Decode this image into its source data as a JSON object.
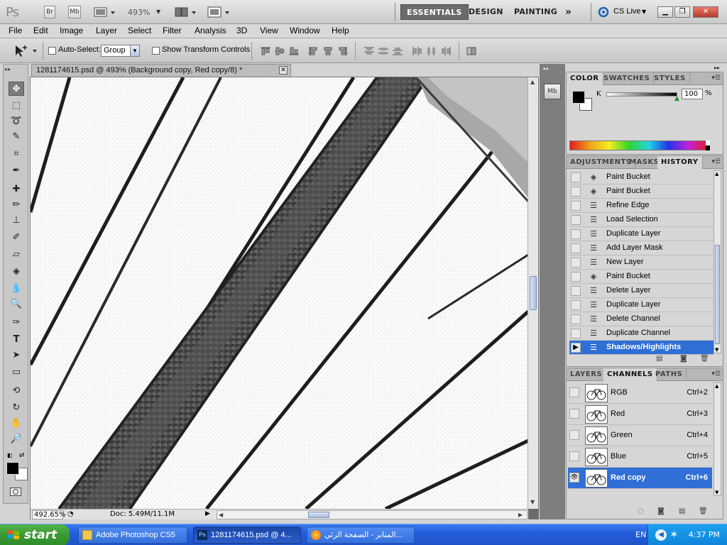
{
  "appbar": {
    "logo": "Ps",
    "btn_br": "Br",
    "btn_mb": "Mb",
    "zoom": "493%",
    "workspaces": [
      "ESSENTIALS",
      "DESIGN",
      "PAINTING"
    ],
    "more": "»",
    "cslive": "CS Live"
  },
  "menu": [
    "File",
    "Edit",
    "Image",
    "Layer",
    "Select",
    "Filter",
    "Analysis",
    "3D",
    "View",
    "Window",
    "Help"
  ],
  "options": {
    "auto_select_label": "Auto-Select:",
    "auto_select_value": "Group",
    "show_transform_label": "Show Transform Controls"
  },
  "document": {
    "tab_title": "1281174615.psd @ 493% (Background copy, Red copy/8) *",
    "zoom_field": "492.65%",
    "doc_info": "Doc: 5.49M/11.1M"
  },
  "color_panel": {
    "tabs": [
      "COLOR",
      "SWATCHES",
      "STYLES"
    ],
    "channel_label": "K",
    "value": "100",
    "unit": "%"
  },
  "history_panel": {
    "tabs": [
      "ADJUSTMENTS",
      "MASKS",
      "HISTORY"
    ],
    "items": [
      {
        "label": "Paint Bucket",
        "icon": "paint-bucket"
      },
      {
        "label": "Paint Bucket",
        "icon": "paint-bucket"
      },
      {
        "label": "Refine Edge",
        "icon": "document-step"
      },
      {
        "label": "Load Selection",
        "icon": "document-step"
      },
      {
        "label": "Duplicate Layer",
        "icon": "document-step"
      },
      {
        "label": "Add Layer Mask",
        "icon": "document-step"
      },
      {
        "label": "New Layer",
        "icon": "document-step"
      },
      {
        "label": "Paint Bucket",
        "icon": "paint-bucket"
      },
      {
        "label": "Delete Layer",
        "icon": "document-step"
      },
      {
        "label": "Duplicate Layer",
        "icon": "document-step"
      },
      {
        "label": "Delete Channel",
        "icon": "document-step"
      },
      {
        "label": "Duplicate Channel",
        "icon": "document-step"
      },
      {
        "label": "Shadows/Highlights",
        "icon": "document-step",
        "selected": true
      }
    ]
  },
  "channels_panel": {
    "tabs": [
      "LAYERS",
      "CHANNELS",
      "PATHS"
    ],
    "items": [
      {
        "label": "RGB",
        "shortcut": "Ctrl+2",
        "visible": false
      },
      {
        "label": "Red",
        "shortcut": "Ctrl+3",
        "visible": false
      },
      {
        "label": "Green",
        "shortcut": "Ctrl+4",
        "visible": false
      },
      {
        "label": "Blue",
        "shortcut": "Ctrl+5",
        "visible": false
      },
      {
        "label": "Red copy",
        "shortcut": "Ctrl+6",
        "visible": true,
        "selected": true
      }
    ]
  },
  "taskbar": {
    "start": "start",
    "tasks": [
      {
        "label": "Adobe Photoshop CS5",
        "icon": "folder-icon"
      },
      {
        "label": "1281174615.psd @ 4...",
        "icon": "photoshop-icon"
      },
      {
        "label": "المنابر - الصفحة الرئي...",
        "icon": "firefox-icon"
      }
    ],
    "lang": "EN",
    "time": "4:37 PM"
  },
  "colors": {
    "selection": "#2f6fd6",
    "taskbar": "#245edc",
    "start": "#3a9a34"
  }
}
